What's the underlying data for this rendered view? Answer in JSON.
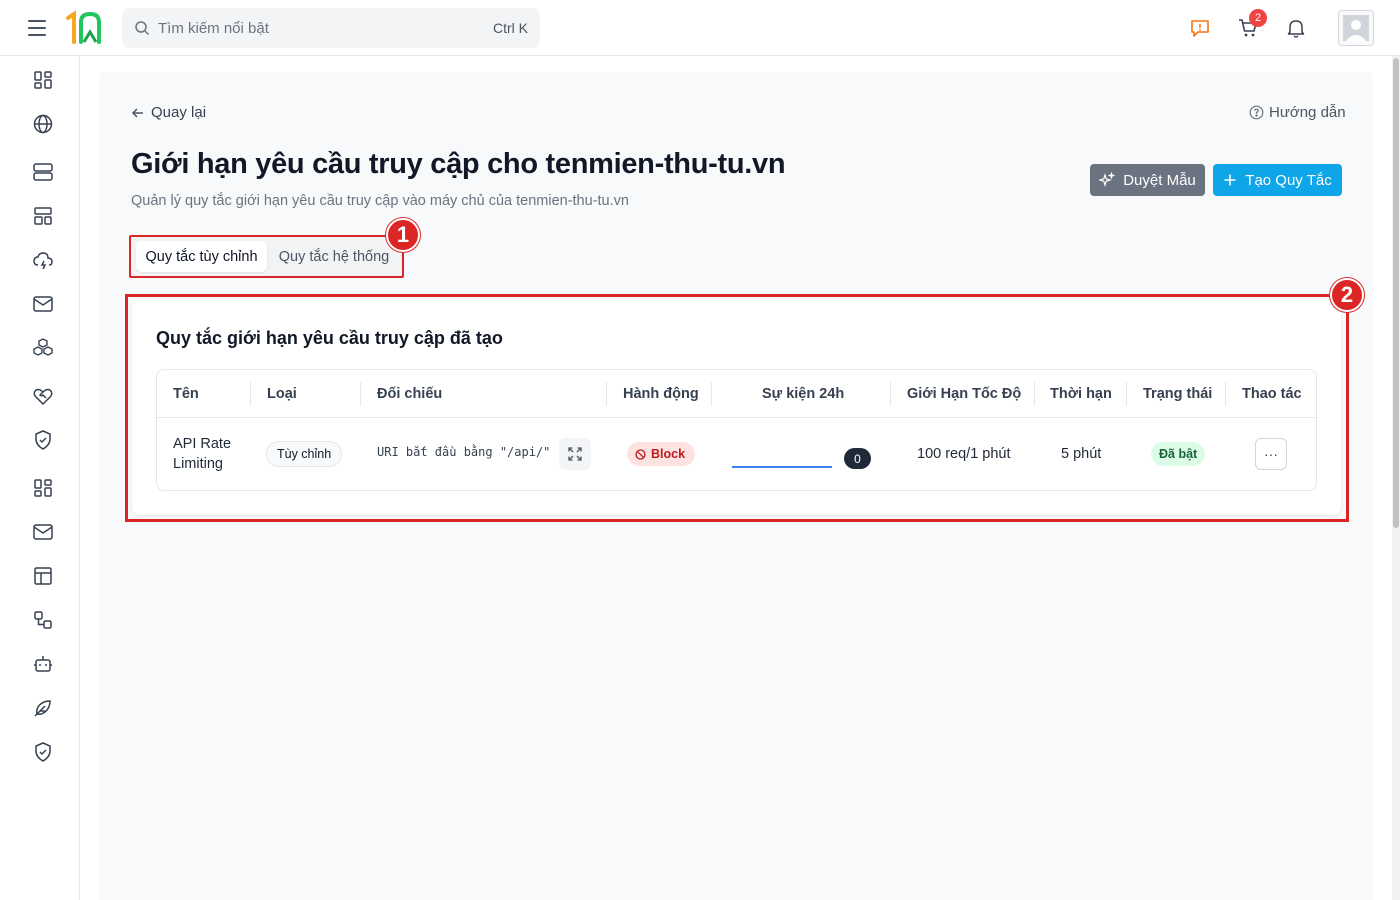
{
  "topbar": {
    "search_placeholder": "Tìm kiếm nổi bật",
    "search_shortcut": "Ctrl K",
    "cart_count": "2"
  },
  "sidebar": {
    "items": [
      {
        "icon": "dashboard-icon"
      },
      {
        "icon": "globe-icon"
      },
      {
        "icon": "server-icon"
      },
      {
        "icon": "layout-icon"
      },
      {
        "icon": "cloud-icon"
      },
      {
        "icon": "mail-icon"
      },
      {
        "icon": "boxes-icon"
      },
      {
        "icon": "heart-handshake-icon"
      },
      {
        "icon": "shield-check-icon"
      },
      {
        "icon": "grid-icon"
      },
      {
        "icon": "mail-icon"
      },
      {
        "icon": "panel-icon"
      },
      {
        "icon": "workflow-icon"
      },
      {
        "icon": "bot-icon"
      },
      {
        "icon": "feather-icon"
      },
      {
        "icon": "shield-check-icon"
      }
    ]
  },
  "header": {
    "back_label": "Quay lại",
    "guide_label": "Hướng dẫn",
    "title": "Giới hạn yêu cầu truy cập cho tenmien-thu-tu.vn",
    "subtitle": "Quản lý quy tắc giới hạn yêu cầu truy cập vào máy chủ của tenmien-thu-tu.vn",
    "browse_templates_label": "Duyệt Mẫu",
    "create_rule_label": "Tạo Quy Tắc"
  },
  "tabs": [
    {
      "label": "Quy tắc tùy chỉnh",
      "active": true
    },
    {
      "label": "Quy tắc hệ thống",
      "active": false
    }
  ],
  "markers": [
    "1",
    "2"
  ],
  "rules_card": {
    "title": "Quy tắc giới hạn yêu cầu truy cập đã tạo",
    "columns": [
      "Tên",
      "Loại",
      "Đối chiếu",
      "Hành động",
      "Sự kiện 24h",
      "Giới Hạn Tốc Độ",
      "Thời hạn",
      "Trạng thái",
      "Thao tác"
    ],
    "rows": [
      {
        "name_line1": "API Rate",
        "name_line2": "Limiting",
        "type": "Tùy chỉnh",
        "match": "URI bắt đầu bằng \"/api/\"",
        "action": "Block",
        "events_24h": "0",
        "rate_limit": "100 req/1 phút",
        "duration": "5 phút",
        "status": "Đã bật",
        "more": "···"
      }
    ]
  },
  "colors": {
    "primary": "#0ea5e9",
    "secondary": "#6b7280",
    "annotation": "#dc2626",
    "block_bg": "#fde2e2",
    "status_bg": "#dcfce7"
  }
}
